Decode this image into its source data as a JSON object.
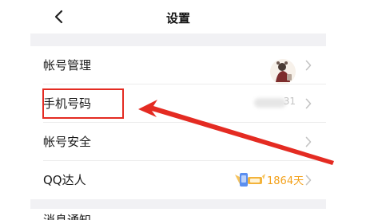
{
  "nav": {
    "title": "设置"
  },
  "rows": [
    {
      "label": "帐号管理"
    },
    {
      "label": "手机号码",
      "value_suffix": "31"
    },
    {
      "label": "帐号安全"
    },
    {
      "label": "QQ达人",
      "days": "1864天"
    }
  ],
  "next_row": {
    "label": "消息通知"
  },
  "colors": {
    "annotation": "#e42b22",
    "accent": "#f3a11b"
  }
}
